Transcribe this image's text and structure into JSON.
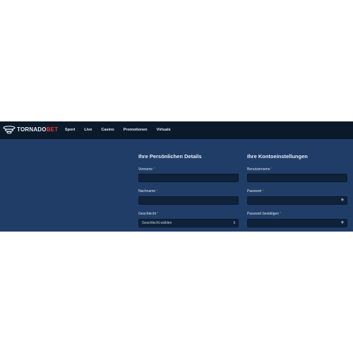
{
  "brand": {
    "name_part1": "TORNADO",
    "name_part2": "BET"
  },
  "nav": {
    "items": [
      "Sport",
      "Live",
      "Casino",
      "Promotionen",
      "Virtuals"
    ]
  },
  "personal": {
    "title": "Ihre Persönlichen Details",
    "firstname_label": "Vorname",
    "lastname_label": "Nachname",
    "gender_label": "Geschlecht",
    "gender_value": "Geschlecht wählen"
  },
  "account": {
    "title": "Ihre Kontoeinstellungen",
    "username_label": "Benutzername",
    "password_label": "Passwort",
    "password_confirm_label": "Passwort bestätigen"
  },
  "required_marker": "*",
  "colors": {
    "topbar": "#0b1a2b",
    "background": "#1f3d67",
    "field": "#0f223a",
    "brand_accent": "#e53935"
  }
}
